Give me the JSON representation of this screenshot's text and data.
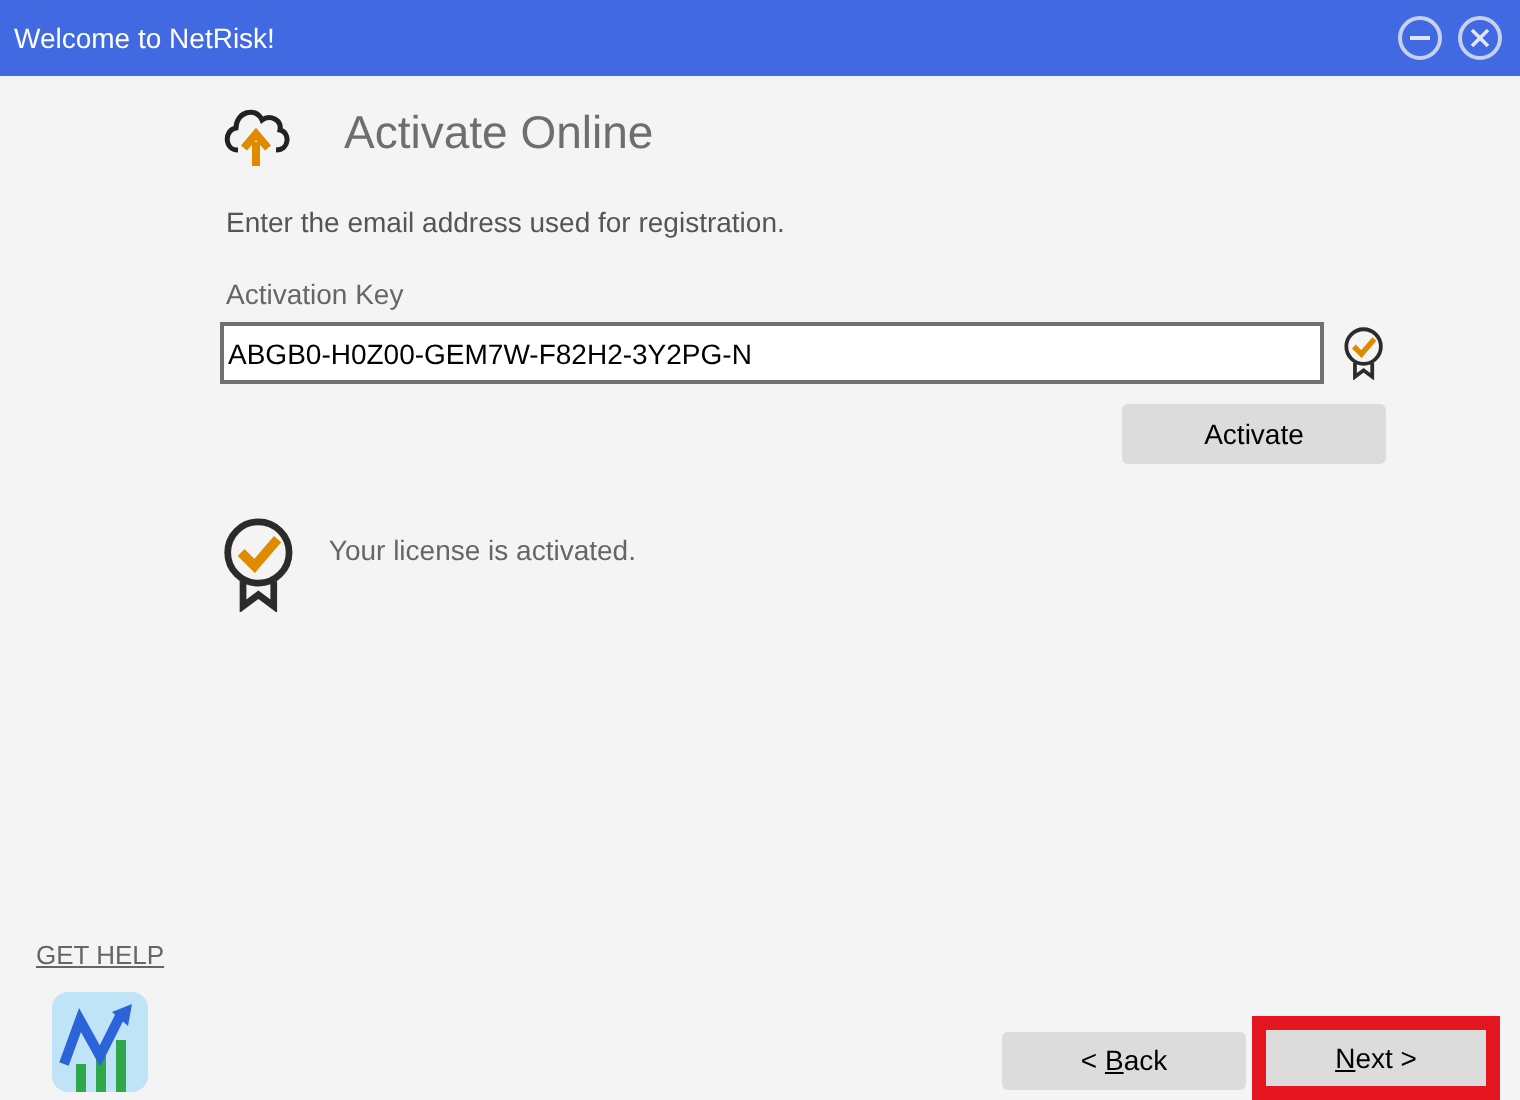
{
  "window": {
    "title": "Welcome to NetRisk!"
  },
  "heading": "Activate Online",
  "instruction": "Enter the email address used for registration.",
  "activation_key": {
    "label": "Activation Key",
    "value": "ABGB0-H0Z00-GEM7W-F82H2-3Y2PG-N",
    "verified": true
  },
  "activate_button": "Activate",
  "status": {
    "text": "Your license is activated.",
    "activated": true
  },
  "help_link": "GET HELP",
  "buttons": [
    {
      "before": "< ",
      "key": "B",
      "after": "ack",
      "highlighted": false
    },
    {
      "key": "N",
      "after": "ext >",
      "highlighted": true
    }
  ]
}
